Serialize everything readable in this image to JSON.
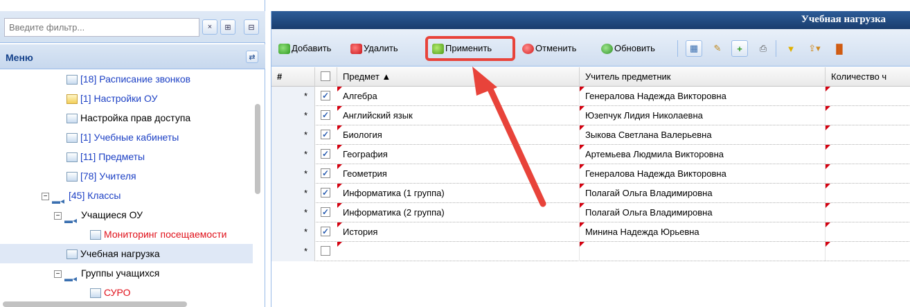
{
  "sidebar": {
    "filter_placeholder": "Введите фильтр...",
    "clear_icon": "×",
    "expand_icon": "⊞",
    "collapse_icon": "⊟",
    "menu_title": "Меню",
    "menu_collapse_icon": "⇄",
    "tree": [
      {
        "label": "[18] Расписание звонков",
        "style": "link"
      },
      {
        "label": "[1] Настройки ОУ",
        "style": "link"
      },
      {
        "label": "Настройка прав доступа",
        "style": "plain"
      },
      {
        "label": "[1] Учебные кабинеты",
        "style": "link"
      },
      {
        "label": "[11] Предметы",
        "style": "link"
      },
      {
        "label": "[78] Учителя",
        "style": "link"
      },
      {
        "label": "[45] Классы",
        "style": "link"
      },
      {
        "label": "Учащиеся ОУ",
        "style": "plain"
      },
      {
        "label": "Мониторинг посещаемости",
        "style": "red"
      },
      {
        "label": "Учебная нагрузка",
        "style": "plain",
        "selected": true
      },
      {
        "label": "Группы учащихся",
        "style": "plain"
      },
      {
        "label": "СУРО",
        "style": "red"
      }
    ]
  },
  "main": {
    "title": "Учебная нагрузка",
    "toolbar": {
      "add": "Добавить",
      "delete": "Удалить",
      "apply": "Применить",
      "cancel": "Отменить",
      "refresh": "Обновить"
    },
    "grid": {
      "columns": [
        "#",
        "Предмет ▲",
        "Учитель предметник",
        "Количество ч"
      ],
      "rows": [
        {
          "marker": "*",
          "checked": true,
          "subject": "Алгебра",
          "teacher": "Генералова Надежда Викторовна"
        },
        {
          "marker": "*",
          "checked": true,
          "subject": "Английский язык",
          "teacher": "Юзепчук Лидия Николаевна"
        },
        {
          "marker": "*",
          "checked": true,
          "subject": "Биология",
          "teacher": "Зыкова Светлана Валерьевна"
        },
        {
          "marker": "*",
          "checked": true,
          "subject": "География",
          "teacher": "Артемьева Людмила Викторовна"
        },
        {
          "marker": "*",
          "checked": true,
          "subject": "Геометрия",
          "teacher": "Генералова Надежда Викторовна"
        },
        {
          "marker": "*",
          "checked": true,
          "subject": "Информатика (1 группа)",
          "teacher": "Полагай Ольга Владимировна"
        },
        {
          "marker": "*",
          "checked": true,
          "subject": "Информатика (2 группа)",
          "teacher": "Полагай Ольга Владимировна"
        },
        {
          "marker": "*",
          "checked": true,
          "subject": "История",
          "teacher": "Минина Надежда Юрьевна"
        },
        {
          "marker": "*",
          "checked": false,
          "subject": "",
          "teacher": ""
        }
      ]
    }
  },
  "colors": {
    "title_bar": "#1f4a82",
    "highlight": "#e8433a",
    "link": "#1b3fc4",
    "red_text": "#e0101a"
  }
}
